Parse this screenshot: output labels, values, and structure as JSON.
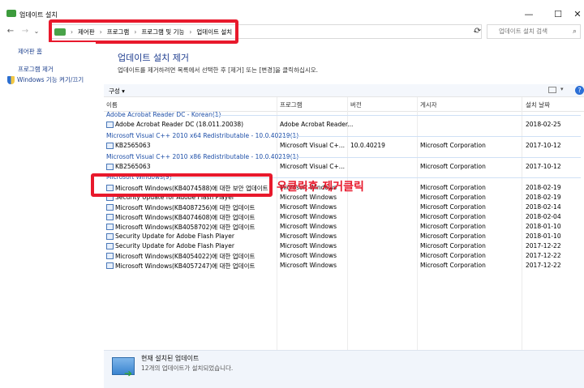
{
  "window": {
    "title": "업데이트 설치",
    "controls": {
      "minimize": "—",
      "maximize": "☐",
      "close": "✕"
    }
  },
  "navigation": {
    "back": "←",
    "forward": "→",
    "recent": "⌄",
    "up": "↑",
    "breadcrumb": [
      "제어판",
      "프로그램",
      "프로그램 및 기능",
      "업데이트 설치"
    ],
    "separator": "›",
    "dropdown": "⌄",
    "refresh": "⟳",
    "search_placeholder": "업데이트 설치 검색",
    "search_icon": "⌕"
  },
  "sidebar": {
    "items": [
      {
        "label": "제어판 홈"
      },
      {
        "label": "프로그램 제거"
      },
      {
        "label": "Windows 기능 켜기/끄기",
        "icon": "shield-icon"
      }
    ]
  },
  "main": {
    "title": "업데이트 설치 제거",
    "description": "업데이트를 제거하려면 목록에서 선택한 후 [제거] 또는 [변경]을 클릭하십시오.",
    "toolbar": {
      "organize": "구성 ▾",
      "help": "?",
      "view_dd": "▾"
    },
    "columns": [
      "이름",
      "프로그램",
      "버전",
      "게시자",
      "설치 날짜"
    ],
    "groups": [
      {
        "label": "Adobe Acrobat Reader DC - Korean(1)",
        "rows": [
          {
            "name": "Adobe Acrobat Reader DC  (18.011.20038)",
            "program": "Adobe Acrobat Reader...",
            "version": "",
            "publisher": "",
            "date": "2018-02-25"
          }
        ]
      },
      {
        "label": "Microsoft Visual C++ 2010  x64 Redistributable - 10.0.40219(1)",
        "rows": [
          {
            "name": "KB2565063",
            "program": "Microsoft Visual C+...",
            "version": "10.0.40219",
            "publisher": "Microsoft Corporation",
            "date": "2017-10-12"
          }
        ]
      },
      {
        "label": "Microsoft Visual C++ 2010  x86 Redistributable - 10.0.40219(1)",
        "rows": [
          {
            "name": "KB2565063",
            "program": "Microsoft Visual C+...",
            "version": "",
            "publisher": "Microsoft Corporation",
            "date": "2017-10-12"
          }
        ]
      },
      {
        "label": "Microsoft Windows(9)",
        "rows": [
          {
            "name": "Microsoft Windows(KB4074588)에 대한 보안 업데이트",
            "program": "Microsoft Windows",
            "version": "",
            "publisher": "Microsoft Corporation",
            "date": "2018-02-19"
          },
          {
            "name": "Security Update for Adobe Flash Player",
            "program": "Microsoft Windows",
            "version": "",
            "publisher": "Microsoft Corporation",
            "date": "2018-02-19"
          },
          {
            "name": "Microsoft Windows(KB4087256)에 대한 업데이트",
            "program": "Microsoft Windows",
            "version": "",
            "publisher": "Microsoft Corporation",
            "date": "2018-02-14"
          },
          {
            "name": "Microsoft Windows(KB4074608)에 대한 업데이트",
            "program": "Microsoft Windows",
            "version": "",
            "publisher": "Microsoft Corporation",
            "date": "2018-02-04"
          },
          {
            "name": "Microsoft Windows(KB4058702)에 대한 업데이트",
            "program": "Microsoft Windows",
            "version": "",
            "publisher": "Microsoft Corporation",
            "date": "2018-01-10"
          },
          {
            "name": "Security Update for Adobe Flash Player",
            "program": "Microsoft Windows",
            "version": "",
            "publisher": "Microsoft Corporation",
            "date": "2018-01-10"
          },
          {
            "name": "Security Update for Adobe Flash Player",
            "program": "Microsoft Windows",
            "version": "",
            "publisher": "Microsoft Corporation",
            "date": "2017-12-22"
          },
          {
            "name": "Microsoft Windows(KB4054022)에 대한 업데이트",
            "program": "Microsoft Windows",
            "version": "",
            "publisher": "Microsoft Corporation",
            "date": "2017-12-22"
          },
          {
            "name": "Microsoft Windows(KB4057247)에 대한 업데이트",
            "program": "Microsoft Windows",
            "version": "",
            "publisher": "Microsoft Corporation",
            "date": "2017-12-22"
          }
        ]
      }
    ]
  },
  "annotation": {
    "text": "우클릭후 제거클릭",
    "color": "#e8192c"
  },
  "details": {
    "title": "현재 설치된 업데이트",
    "count_text": "12개의 업데이트가 설치되었습니다."
  }
}
